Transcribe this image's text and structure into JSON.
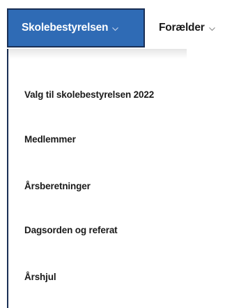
{
  "nav": {
    "active_label": "Skolebestyrelsen",
    "active_icon": "chevron-down-icon",
    "next_label": "Forælder",
    "next_icon": "chevron-down-icon",
    "active_bg": "#2f6bb5",
    "active_border": "#1a2f55"
  },
  "dropdown": {
    "items": [
      {
        "label": "Valg til skolebestyrelsen 2022"
      },
      {
        "label": "Medlemmer"
      },
      {
        "label": "Årsberetninger"
      },
      {
        "label": "Dagsorden og referat"
      },
      {
        "label": "Årshjul"
      }
    ]
  }
}
